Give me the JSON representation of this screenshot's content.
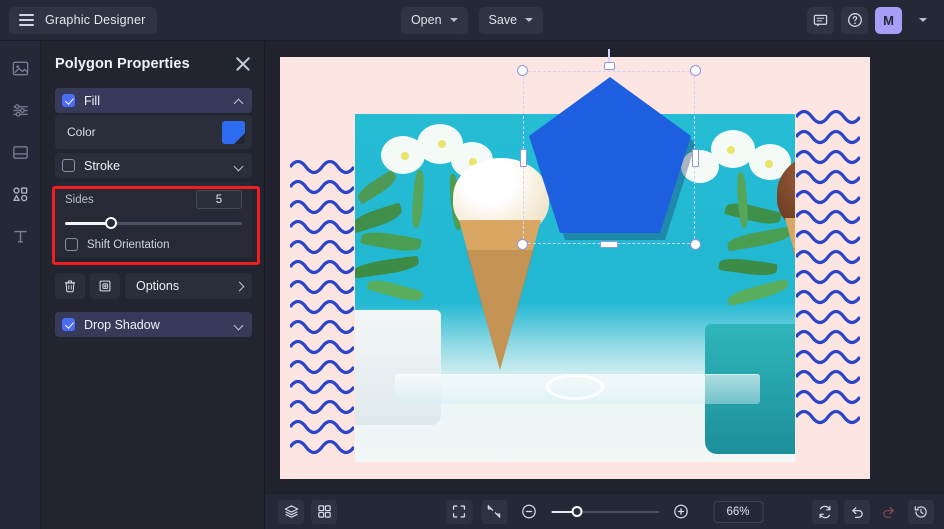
{
  "topbar": {
    "menu_icon": "hamburger-icon",
    "app_title": "Graphic Designer",
    "open_label": "Open",
    "save_label": "Save",
    "comment_icon": "comment-icon",
    "help_icon": "help-circle-icon",
    "avatar_initial": "M",
    "avatar_caret_icon": "chevron-down-icon"
  },
  "rail": {
    "items": [
      {
        "name": "image-tool",
        "icon": "image-icon"
      },
      {
        "name": "adjustments-tool",
        "icon": "sliders-icon"
      },
      {
        "name": "layout-tool",
        "icon": "layout-frame-icon"
      },
      {
        "name": "shapes-tool",
        "icon": "shapes-icon"
      },
      {
        "name": "text-tool",
        "icon": "text-t-icon"
      }
    ]
  },
  "panel": {
    "title": "Polygon Properties",
    "close_icon": "close-icon",
    "fill": {
      "label": "Fill",
      "checked": true,
      "chevron": "chevron-up-icon"
    },
    "color": {
      "label": "Color",
      "swatch_hex": "#2d6cf0"
    },
    "stroke": {
      "label": "Stroke",
      "checked": false,
      "chevron": "chevron-down-icon"
    },
    "sides": {
      "label": "Sides",
      "value": "5",
      "slider_percent": 26
    },
    "shift_orientation": {
      "label": "Shift Orientation",
      "checked": false
    },
    "actions": {
      "delete_icon": "trash-icon",
      "duplicate_icon": "duplicate-icon",
      "options_label": "Options",
      "options_chevron": "chevron-right-icon"
    },
    "drop_shadow": {
      "label": "Drop Shadow",
      "checked": true,
      "chevron": "chevron-down-icon"
    },
    "highlight_color": "#ef1f1f"
  },
  "canvas": {
    "artboard_bg": "#fde6e1",
    "wave_color": "#2b44c8",
    "photo_alt": "two ice cream cones on a clear stand with teal background and white flowers",
    "shape": {
      "name": "pentagon",
      "fill_hex": "#1e5fe0",
      "sides": 5,
      "selected": true,
      "handles": [
        "top-left",
        "top-right",
        "bottom-left",
        "bottom-right",
        "top-mid",
        "bottom-mid",
        "left-mid",
        "right-mid",
        "rotate"
      ]
    }
  },
  "bottombar": {
    "layers_icon": "layers-icon",
    "grid_icon": "grid-icon",
    "fit_frame_icon": "fit-frame-icon",
    "fit_content_icon": "collapse-arrows-icon",
    "zoom_out_icon": "zoom-out-icon",
    "zoom_in_icon": "zoom-in-icon",
    "zoom_value": "66%",
    "zoom_slider_percent": 24,
    "refresh_icon": "refresh-icon",
    "undo_icon": "undo-icon",
    "redo_icon": "redo-icon",
    "history_icon": "history-icon"
  }
}
